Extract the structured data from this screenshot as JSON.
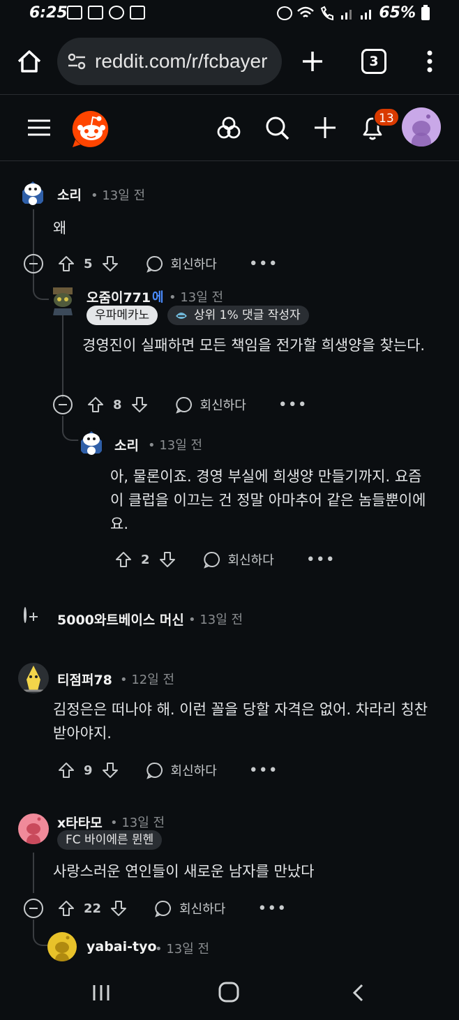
{
  "status_bar": {
    "time": "6:25",
    "battery": "65%"
  },
  "browser": {
    "url": "reddit.com/r/fcbayer",
    "tab_count": "3"
  },
  "header": {
    "notification_count": "13",
    "colors": {
      "badge": "#d93a00",
      "logo": "#ff4500",
      "avatar_bg": "#c9a8e8"
    }
  },
  "comments": [
    {
      "user": "소리",
      "time": "13일 전",
      "body": "왜",
      "score": "5",
      "reply": "회신하다"
    },
    {
      "user": "오줌이771",
      "op_mark": "에",
      "time": "13일 전",
      "flair": "우파메카노",
      "badge": "상위 1% 댓글 작성자",
      "body": "경영진이 실패하면 모든 책임을 전가할 희생양을 찾는다.",
      "score": "8",
      "reply": "회신하다"
    },
    {
      "user": "소리",
      "time": "13일 전",
      "body": "아, 물론이죠. 경영 부실에 희생양 만들기까지. 요즘 이 클럽을 이끄는 건 정말 아마추어 같은 놈들뿐이에요.",
      "score": "2",
      "reply": "회신하다"
    },
    {
      "user": "5000와트베이스 머신",
      "time": "13일 전"
    },
    {
      "user": "티점퍼78",
      "time": "12일 전",
      "body": "김정은은 떠나야 해. 이런 꼴을 당할 자격은 없어. 차라리 칭찬받아야지.",
      "score": "9",
      "reply": "회신하다"
    },
    {
      "user": "x타타모",
      "time": "13일 전",
      "flair": "FC 바이에른 뮌헨",
      "body": "사랑스러운 연인들이 새로운 남자를 만났다",
      "score": "22",
      "reply": "회신하다"
    },
    {
      "user": "yabai-tyo",
      "time": "13일 전"
    }
  ]
}
